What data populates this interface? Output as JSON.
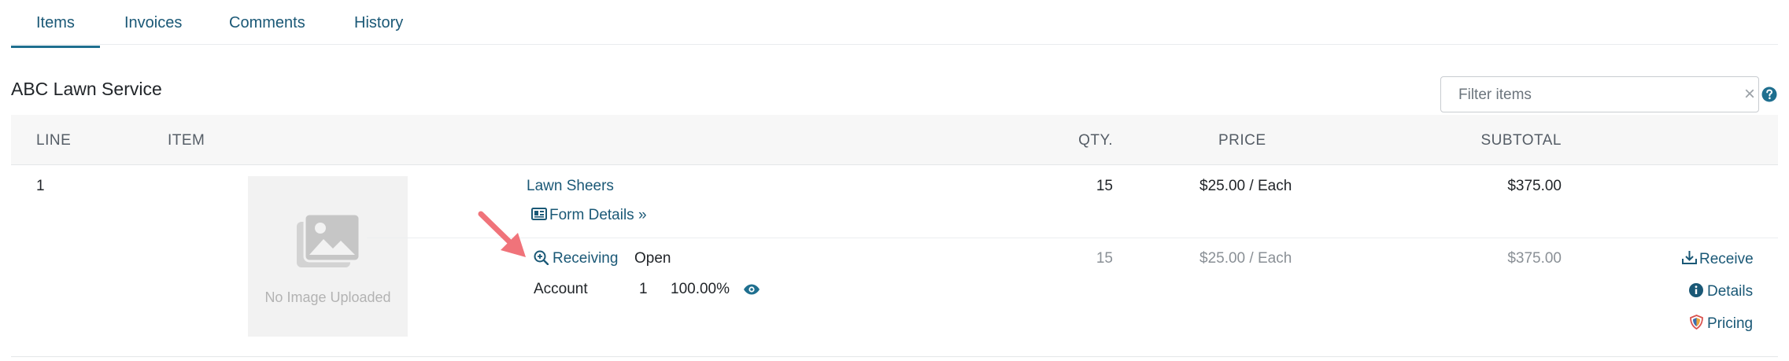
{
  "tabs": [
    {
      "label": "Items",
      "active": true
    },
    {
      "label": "Invoices",
      "active": false
    },
    {
      "label": "Comments",
      "active": false
    },
    {
      "label": "History",
      "active": false
    }
  ],
  "vendor": {
    "name": "ABC Lawn Service"
  },
  "filter": {
    "placeholder": "Filter items",
    "value": "",
    "clear_glyph": "×"
  },
  "table": {
    "headers": {
      "line": "LINE",
      "item": "ITEM",
      "qty": "QTY.",
      "price": "PRICE",
      "subtotal": "SUBTOTAL"
    },
    "rows": [
      {
        "line": "1",
        "image_placeholder": "No Image Uploaded",
        "item_name": "Lawn Sheers",
        "form_details": "Form Details »",
        "qty": "15",
        "price": "$25.00 / Each",
        "subtotal": "$375.00",
        "receiving": {
          "label": "Receiving",
          "status": "Open",
          "qty": "15",
          "price": "$25.00 / Each",
          "subtotal": "$375.00"
        },
        "account": {
          "label": "Account",
          "number": "1",
          "percent": "100.00%"
        },
        "actions": {
          "receive": "Receive",
          "details": "Details",
          "pricing": "Pricing"
        }
      }
    ]
  },
  "colors": {
    "link": "#1a5876",
    "annotation_arrow": "#f0737a",
    "header_bg": "#f7f7f7"
  },
  "icons": [
    "help-icon",
    "image-placeholder-icon",
    "id-card-icon",
    "zoom-in-icon",
    "eye-icon",
    "download-tray-icon",
    "info-icon",
    "shield-icon",
    "annotation-arrow"
  ]
}
